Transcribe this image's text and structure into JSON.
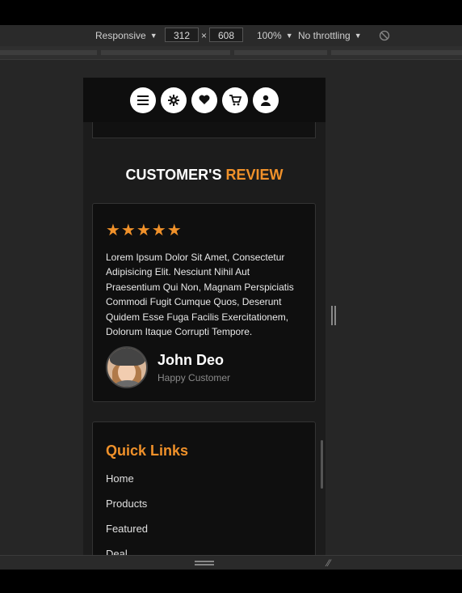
{
  "devtools": {
    "device_mode": "Responsive",
    "width": "312",
    "times": "×",
    "height": "608",
    "zoom": "100%",
    "throttling": "No throttling",
    "rotate_icon": "rotate-icon"
  },
  "nav": {
    "icons": [
      "menu-icon",
      "settings-icon",
      "heart-icon",
      "cart-icon",
      "user-icon"
    ]
  },
  "review_section": {
    "title_main": "CUSTOMER'S ",
    "title_accent": "REVIEW"
  },
  "review": {
    "rating": 5,
    "stars_text": "★★★★★",
    "text": "Lorem Ipsum Dolor Sit Amet, Consectetur Adipisicing Elit. Nesciunt Nihil Aut Praesentium Qui Non, Magnam Perspiciatis Commodi Fugit Cumque Quos, Deserunt Quidem Esse Fuga Facilis Exercitationem, Dolorum Itaque Corrupti Tempore.",
    "name": "John Deo",
    "role": "Happy Customer"
  },
  "quick_links": {
    "title": "Quick Links",
    "items": [
      "Home",
      "Products",
      "Featured",
      "Deal"
    ]
  },
  "colors": {
    "accent": "#f0912a",
    "card_bg": "#0f0f0f",
    "page_bg": "#1c1c1c"
  }
}
